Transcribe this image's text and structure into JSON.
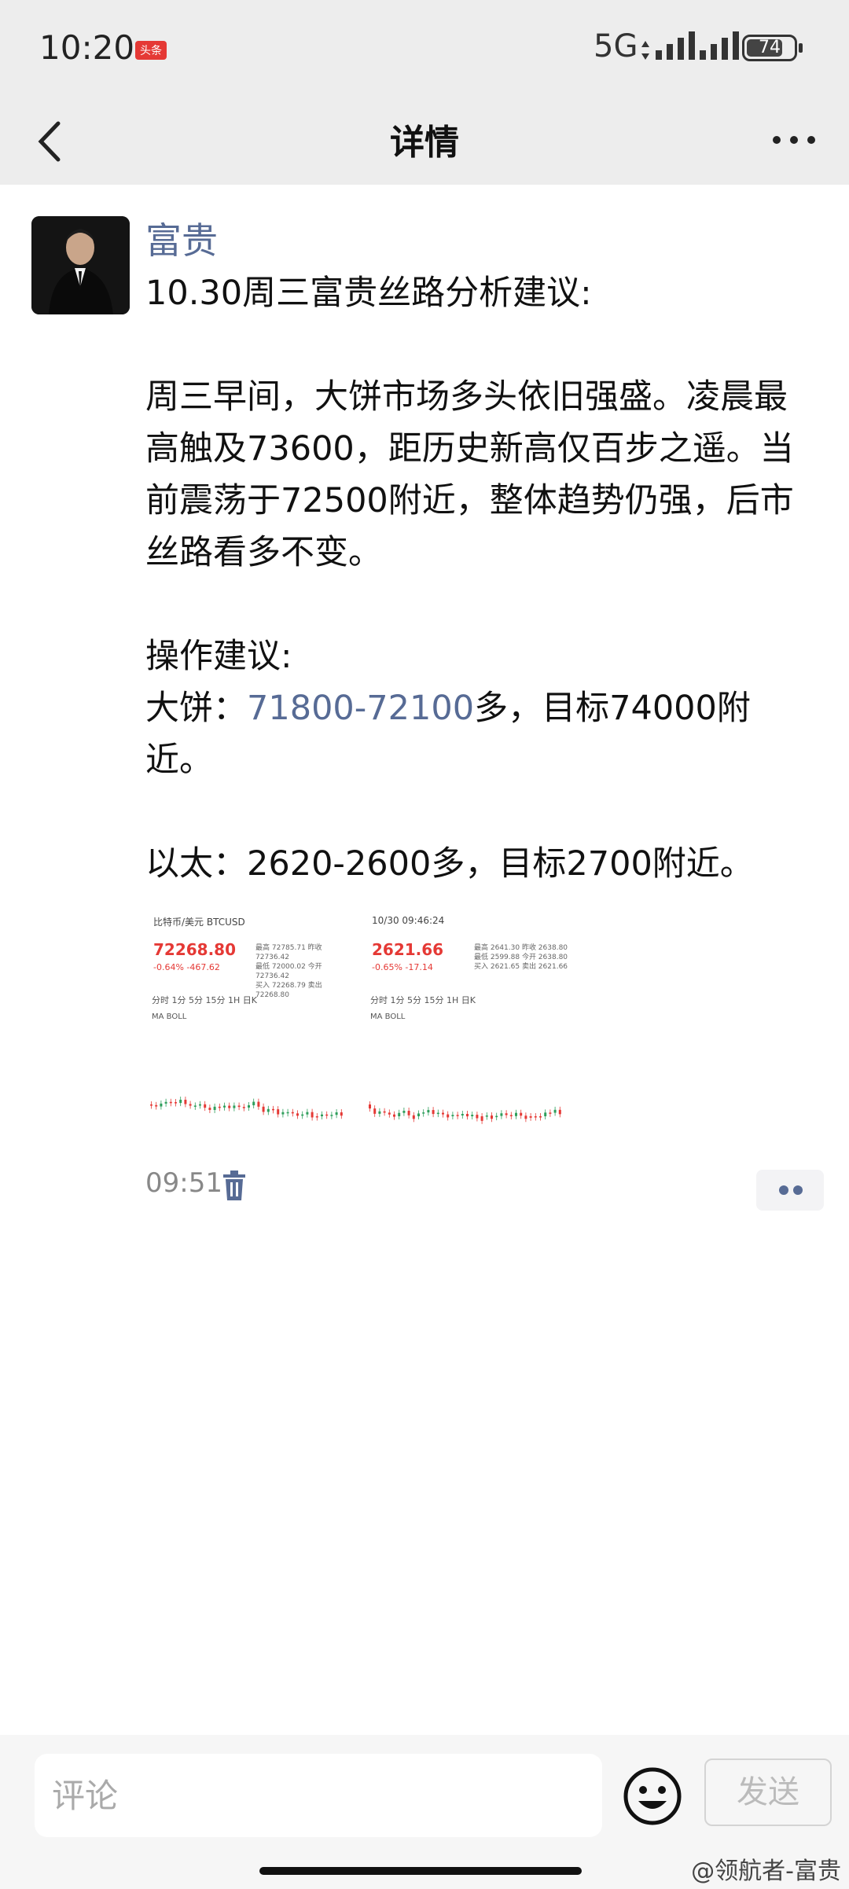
{
  "status": {
    "time": "10:20",
    "badge": "头条",
    "network": "5G",
    "battery": "74"
  },
  "nav": {
    "title": "详情"
  },
  "post": {
    "author": "富贵",
    "title_line": "10.30周三富贵丝路分析建议:",
    "para1": "周三早间，大饼市场多头依旧强盛。凌晨最高触及73600，距历史新高仅百步之遥。当前震荡于72500附近，整体趋势仍强，后市丝路看多不变。",
    "ops_title": "操作建议:",
    "btc_prefix": "大饼：",
    "btc_range": "71800-72100",
    "btc_suffix": "多，目标74000附近。",
    "eth_line": "以太：2620-2600多，目标2700附近。",
    "time": "09:51"
  },
  "images": [
    {
      "title": "比特币/美元 BTCUSD",
      "price": "72268.80",
      "change": "-0.64%  -467.62",
      "tabs": "分时   1分   5分   15分   1H   日K",
      "ma": "MA  BOLL",
      "stats": [
        "最高 72785.71  昨收 72736.42",
        "最低 72000.02  今开 72736.42",
        "买入 72268.79  卖出 72268.80"
      ]
    },
    {
      "title": "10/30 09:46:24",
      "price": "2621.66",
      "change": "-0.65%  -17.14",
      "tabs": "分时   1分   5分   15分   1H   日K",
      "ma": "MA  BOLL",
      "stats": [
        "最高 2641.30  昨收 2638.80",
        "最低 2599.88  今开 2638.80",
        "买入 2621.65  卖出 2621.66"
      ]
    }
  ],
  "bottom": {
    "comment_placeholder": "评论",
    "send_label": "发送",
    "watermark": "@领航者-富贵"
  }
}
